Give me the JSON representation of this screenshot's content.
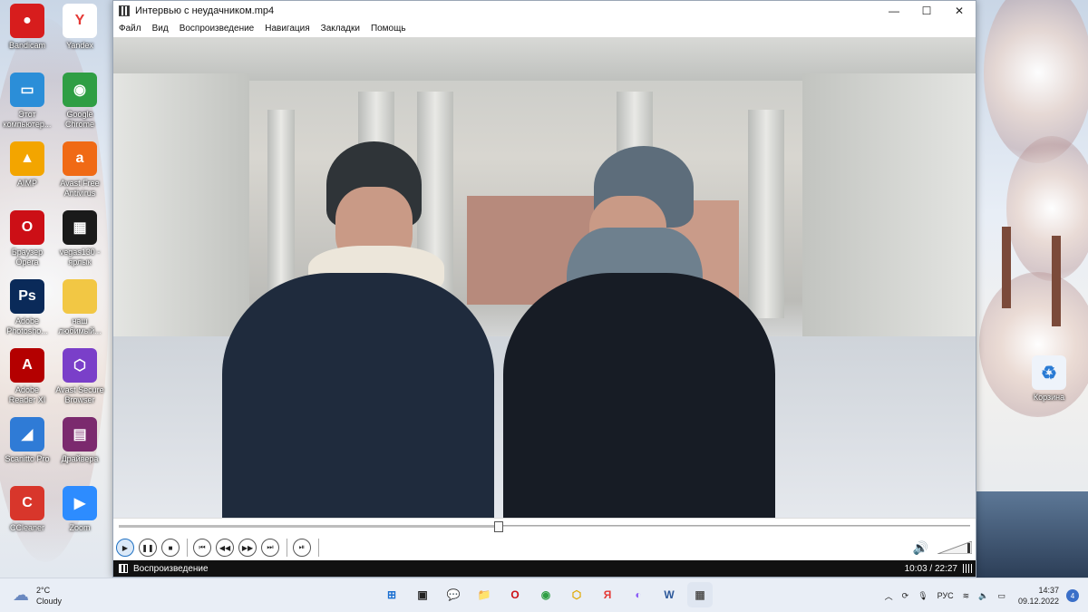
{
  "desktop": {
    "icons_left": [
      {
        "label": "Bandicam",
        "icon": "bandicam-icon",
        "color": "#d71d1d",
        "glyph": "●"
      },
      {
        "label": "Этот\nкомпьютер...",
        "icon": "computer-icon",
        "color": "#2b8ed8",
        "glyph": "▭"
      },
      {
        "label": "AIMP",
        "icon": "aimp-icon",
        "color": "#f3a500",
        "glyph": "▲"
      },
      {
        "label": "Браузер\nOpera",
        "icon": "opera-icon",
        "color": "#cc0f16",
        "glyph": "O"
      },
      {
        "label": "Adobe\nPhotosho...",
        "icon": "photoshop-icon",
        "color": "#0a2a59",
        "glyph": "Ps"
      },
      {
        "label": "Adobe\nReader XI",
        "icon": "adobe-reader-icon",
        "color": "#b40000",
        "glyph": "A"
      },
      {
        "label": "Scanitto Pro",
        "icon": "scanitto-icon",
        "color": "#2f7bd6",
        "glyph": "◢"
      },
      {
        "label": "CCleaner",
        "icon": "ccleaner-icon",
        "color": "#d8362b",
        "glyph": "C"
      }
    ],
    "icons_right": [
      {
        "label": "Yandex",
        "icon": "yandex-icon",
        "color": "#ffffff",
        "glyph": "Y"
      },
      {
        "label": "Google\nChrome",
        "icon": "chrome-icon",
        "color": "#2f9e44",
        "glyph": "◉"
      },
      {
        "label": "Avast Free\nAntivirus",
        "icon": "avast-icon",
        "color": "#f06a15",
        "glyph": "a"
      },
      {
        "label": "vegas130 -\nярлык",
        "icon": "vegas-icon",
        "color": "#1a1a1a",
        "glyph": "▦"
      },
      {
        "label": "наш\nлюбимый...",
        "icon": "folder-icon",
        "color": "#f2c744",
        "glyph": ""
      },
      {
        "label": "Avast Secure\nBrowser",
        "icon": "avast-browser-icon",
        "color": "#7a3fc9",
        "glyph": "⬡"
      },
      {
        "label": "Драйвера",
        "icon": "winrar-icon",
        "color": "#7b2a6e",
        "glyph": "▤"
      },
      {
        "label": "Zoom",
        "icon": "zoom-icon",
        "color": "#2d8cff",
        "glyph": "▶"
      }
    ],
    "recycle_bin": {
      "label": "Корзина",
      "icon": "recycle-bin-icon"
    }
  },
  "window": {
    "title": "Интервью с неудачником.mp4",
    "controls": {
      "minimize": "—",
      "maximize": "☐",
      "close": "✕"
    },
    "menu": [
      "Файл",
      "Вид",
      "Воспроизведение",
      "Навигация",
      "Закладки",
      "Помощь"
    ]
  },
  "player": {
    "progress": 0.446,
    "buttons": [
      {
        "name": "play-button",
        "glyph": "▶",
        "active": true
      },
      {
        "name": "pause-button",
        "glyph": "❚❚"
      },
      {
        "name": "stop-button",
        "glyph": "■"
      },
      {
        "name": "prev-button",
        "glyph": "⏮"
      },
      {
        "name": "rewind-button",
        "glyph": "◀◀"
      },
      {
        "name": "forward-button",
        "glyph": "▶▶"
      },
      {
        "name": "next-button",
        "glyph": "⏭"
      },
      {
        "name": "frame-step-button",
        "glyph": "⏯"
      }
    ],
    "volume_icon": "🔊",
    "status_text": "Воспроизведение",
    "time": "10:03 / 22:27"
  },
  "taskbar": {
    "weather_temp": "2°C",
    "weather_desc": "Cloudy",
    "apps": [
      {
        "name": "start-icon",
        "glyph": "⊞",
        "color": "#1a6fd1"
      },
      {
        "name": "taskview-icon",
        "glyph": "▣",
        "color": "#222"
      },
      {
        "name": "chat-icon",
        "glyph": "💬",
        "color": "#6a5acd"
      },
      {
        "name": "explorer-icon",
        "glyph": "📁",
        "color": "#e8b400"
      },
      {
        "name": "opera-taskbar-icon",
        "glyph": "O",
        "color": "#cc0f16"
      },
      {
        "name": "chrome-taskbar-icon",
        "glyph": "◉",
        "color": "#2f9e44"
      },
      {
        "name": "avast-taskbar-icon",
        "glyph": "⬡",
        "color": "#e0a800"
      },
      {
        "name": "yandex-taskbar-icon",
        "glyph": "Я",
        "color": "#e53935"
      },
      {
        "name": "alice-taskbar-icon",
        "glyph": "◐",
        "color": "#8b5cf6"
      },
      {
        "name": "word-taskbar-icon",
        "glyph": "W",
        "color": "#2b579a"
      },
      {
        "name": "mpc-taskbar-icon",
        "glyph": "▦",
        "color": "#555"
      }
    ],
    "tray": {
      "language": "РУС",
      "time": "14:37",
      "date": "09.12.2022",
      "notifications": "4"
    }
  }
}
